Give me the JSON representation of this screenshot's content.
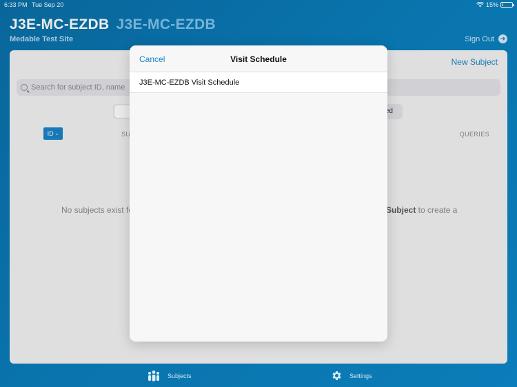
{
  "status_bar": {
    "time": "6:33 PM",
    "date": "Tue Sep 20",
    "battery": "15%",
    "battery_level": 0.15
  },
  "header": {
    "title_primary": "J3E-MC-EZDB",
    "title_secondary": "J3E-MC-EZDB",
    "subtitle": "Medable Test Site",
    "sign_out_label": "Sign Out"
  },
  "main": {
    "new_subject_label": "New Subject",
    "search_placeholder": "Search for subject ID, name",
    "segment_right_fragment": "ed",
    "id_sort_label": "ID",
    "col_subject_fragment": "SU",
    "col_queries": "QUERIES",
    "empty_left": "No subjects exist fo",
    "empty_right_bold": "Subject",
    "empty_right_rest": " to create a"
  },
  "tabs": [
    {
      "label": "Subjects",
      "icon": "people-icon"
    },
    {
      "label": "Settings",
      "icon": "gear-icon"
    }
  ],
  "modal": {
    "cancel_label": "Cancel",
    "title": "Visit Schedule",
    "items": [
      {
        "label": "J3E-MC-EZDB Visit Schedule"
      }
    ]
  },
  "colors": {
    "accent": "#1b84c6",
    "background": "#0a7fbd",
    "battery": "#f5c400"
  }
}
